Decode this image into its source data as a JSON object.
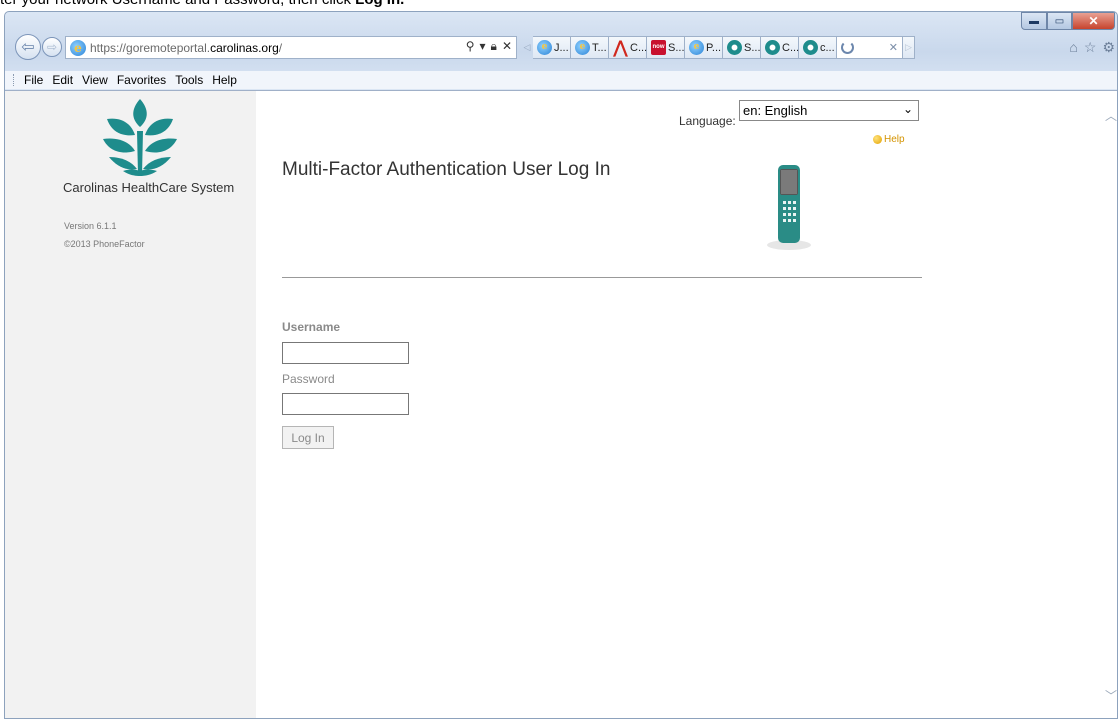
{
  "instruction": {
    "prefix": "ter your network Username and Password, then click ",
    "bold": "Log In."
  },
  "browser": {
    "url_prefix": "https://goremoteportal.",
    "url_domain": "carolinas.org",
    "url_suffix": "/",
    "tabs": [
      {
        "label": "J...",
        "icon": "ie-icon"
      },
      {
        "label": "T...",
        "icon": "ie-icon"
      },
      {
        "label": "C...",
        "icon": "acrobat-icon"
      },
      {
        "label": "S...",
        "icon": "servicenow-icon"
      },
      {
        "label": "P...",
        "icon": "ie-icon"
      },
      {
        "label": "S...",
        "icon": "chs-icon"
      },
      {
        "label": "C...",
        "icon": "chs-icon"
      },
      {
        "label": "c...",
        "icon": "chs-icon"
      },
      {
        "label": "",
        "icon": "loading-icon",
        "active": true
      }
    ],
    "menu": [
      "File",
      "Edit",
      "View",
      "Favorites",
      "Tools",
      "Help"
    ]
  },
  "sidebar": {
    "org_name": "Carolinas HealthCare System",
    "version": "Version 6.1.1",
    "copyright": "©2013 PhoneFactor"
  },
  "page": {
    "language_label": "Language:",
    "language_value": "en: English",
    "help": "Help",
    "title": "Multi-Factor Authentication User Log In",
    "username_label": "Username",
    "username_value": "",
    "password_label": "Password",
    "password_value": "",
    "login_button": "Log In"
  },
  "colors": {
    "brand_teal": "#1e8c8c",
    "label_gray": "#8a8a8a",
    "help_orange": "#d49300"
  }
}
